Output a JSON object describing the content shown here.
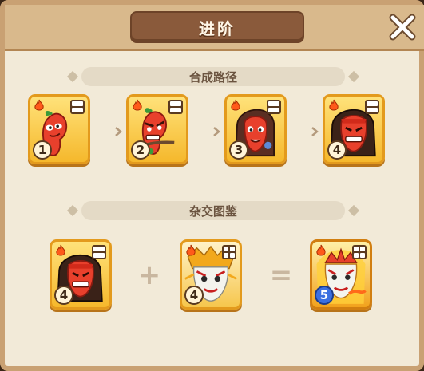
{
  "window": {
    "title": "进阶"
  },
  "sections": {
    "path_title": "合成路径",
    "cross_title": "杂交图鉴"
  },
  "path_cards": [
    {
      "level": "1",
      "slots": 2
    },
    {
      "level": "2",
      "slots": 2
    },
    {
      "level": "3",
      "slots": 2
    },
    {
      "level": "4",
      "slots": 2
    }
  ],
  "cross_cards": [
    {
      "level": "4",
      "slots": 2
    },
    {
      "level": "4",
      "slots": 4
    },
    {
      "level": "5",
      "slots": 4
    }
  ],
  "operators": {
    "plus": "+",
    "equals": "="
  },
  "colors": {
    "card_gold": "#f5b82c",
    "title_brown": "#8a5a3b",
    "panel_bg": "#f2ead8",
    "level5_blue": "#3b6fe0"
  },
  "icons": {
    "close": "close-icon",
    "flame": "flame-icon",
    "slots": "grid-slot-icon",
    "arrow": "chevron-right-icon"
  }
}
